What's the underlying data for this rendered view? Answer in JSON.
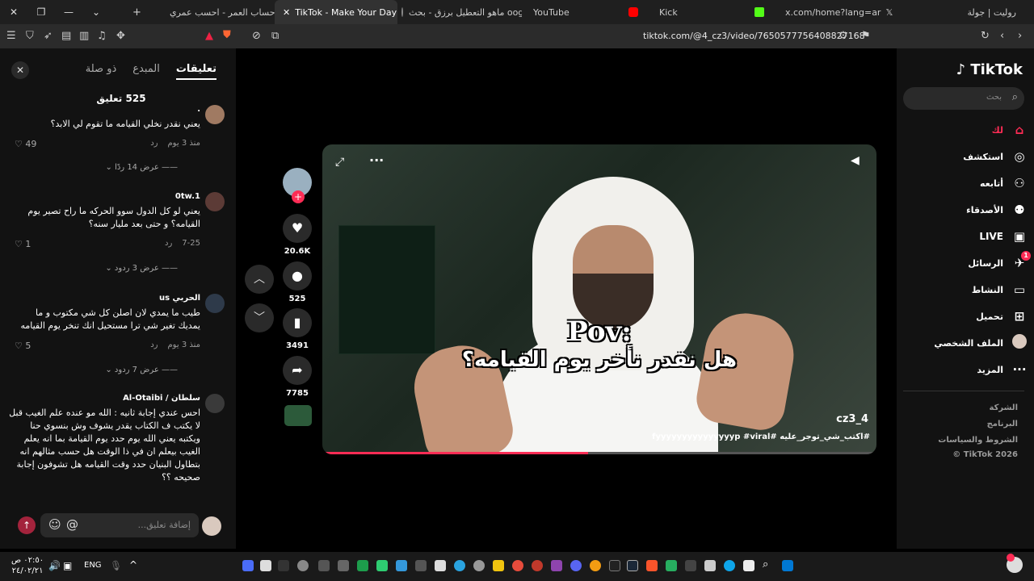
{
  "browser": {
    "tabs": [
      {
        "label": "حساب العمر - احسب عمري"
      },
      {
        "label": "TikTok - Make Your Day"
      },
      {
        "label": "ماهو التعطيل برزق - بحث oogle"
      },
      {
        "label": "YouTube"
      },
      {
        "label": "Kick"
      },
      {
        "label": "x.com/home?lang=ar"
      },
      {
        "label": "روليت | جولة"
      }
    ],
    "url": "tiktok.com/@4_cz3/video/7650577756408827168"
  },
  "comments_panel": {
    "tab_comments": "تعليقات",
    "tab_creator": "المبدع",
    "tab_related": "ذو صلة",
    "count_label": "525 تعليق",
    "comments": [
      {
        "user": ".",
        "text": "يعني نقدر نخلي القيامه ما تقوم لي الابد؟",
        "time": "منذ 3 يوم",
        "reply": "رد",
        "likes": "49",
        "replies": "عرض 14 ردًا"
      },
      {
        "user": "0tw.1",
        "text": "يعني لو كل الدول سوو الحركه ما راح تصير يوم القيامه؟ و حتى بعد مليار سنه؟",
        "time": "7-25",
        "reply": "رد",
        "likes": "1",
        "replies": "عرض 3 ردود"
      },
      {
        "user": "الحربي us",
        "text": "طيب ما يمدي لان اصلن كل شي مكتوب و ما يمديك تغير شي ترا مستحيل انك تنخر يوم القيامه",
        "time": "منذ 3 يوم",
        "reply": "رد",
        "likes": "5",
        "replies": "عرض 7 ردود"
      },
      {
        "user": "سلطان / Al-Otaibi",
        "text": "احس عندي إجابة ثانيه : الله مو عنده علم الغيب قبل لا يكتب ف الكتاب يقدر يشوف وش بنسوي حنا ويكتبه يعني الله يوم حدد يوم القيامة بما انه يعلم الغيب بيعلم ان في ذا الوقت هل حسب مثالهم انه بتطاول البنيان حدد وقت القيامه هل تشوفون إجابة صحيحه ؟؟",
        "time": "",
        "reply": "",
        "likes": "",
        "replies": ""
      }
    ],
    "composer_placeholder": "إضافة تعليق...",
    "at_symbol": "@",
    "emoji_symbol": "☺"
  },
  "actions": {
    "likes": "20.6K",
    "comments": "525",
    "saves": "3491",
    "shares": "7785"
  },
  "video": {
    "caption_line1": "Pov:",
    "caption_line2": "هل نقدر نأخر يوم القيامه؟",
    "author": "cz3_4",
    "tags": "#اكتب_شي_توجر_عليه #fyyyyyyyyyyyyyyyp #viral",
    "progress": 0.48
  },
  "sidebar": {
    "logo": "TikTok",
    "search_placeholder": "بحث",
    "nav": [
      {
        "label": "لك",
        "icon": "home-icon"
      },
      {
        "label": "استكشف",
        "icon": "compass-icon"
      },
      {
        "label": "أتابعه",
        "icon": "user-follow-icon"
      },
      {
        "label": "الأصدقاء",
        "icon": "friends-icon"
      },
      {
        "label": "LIVE",
        "icon": "live-icon"
      },
      {
        "label": "الرسائل",
        "icon": "messages-icon",
        "badge": "1"
      },
      {
        "label": "النشاط",
        "icon": "activity-icon"
      },
      {
        "label": "تحميل",
        "icon": "upload-icon"
      },
      {
        "label": "الملف الشخصي",
        "icon": "profile-icon"
      },
      {
        "label": "المزيد",
        "icon": "more-icon"
      }
    ],
    "footer": [
      "الشركة",
      "البرنامج",
      "الشروط والسياسات",
      "TikTok 2026 ©"
    ]
  },
  "taskbar": {
    "time": "٠٢:٥٠ ص",
    "date": "٢٤/٠٢/٢١",
    "lang": "ENG"
  },
  "colors": {
    "accent": "#fe2c55",
    "panel": "#121212"
  }
}
